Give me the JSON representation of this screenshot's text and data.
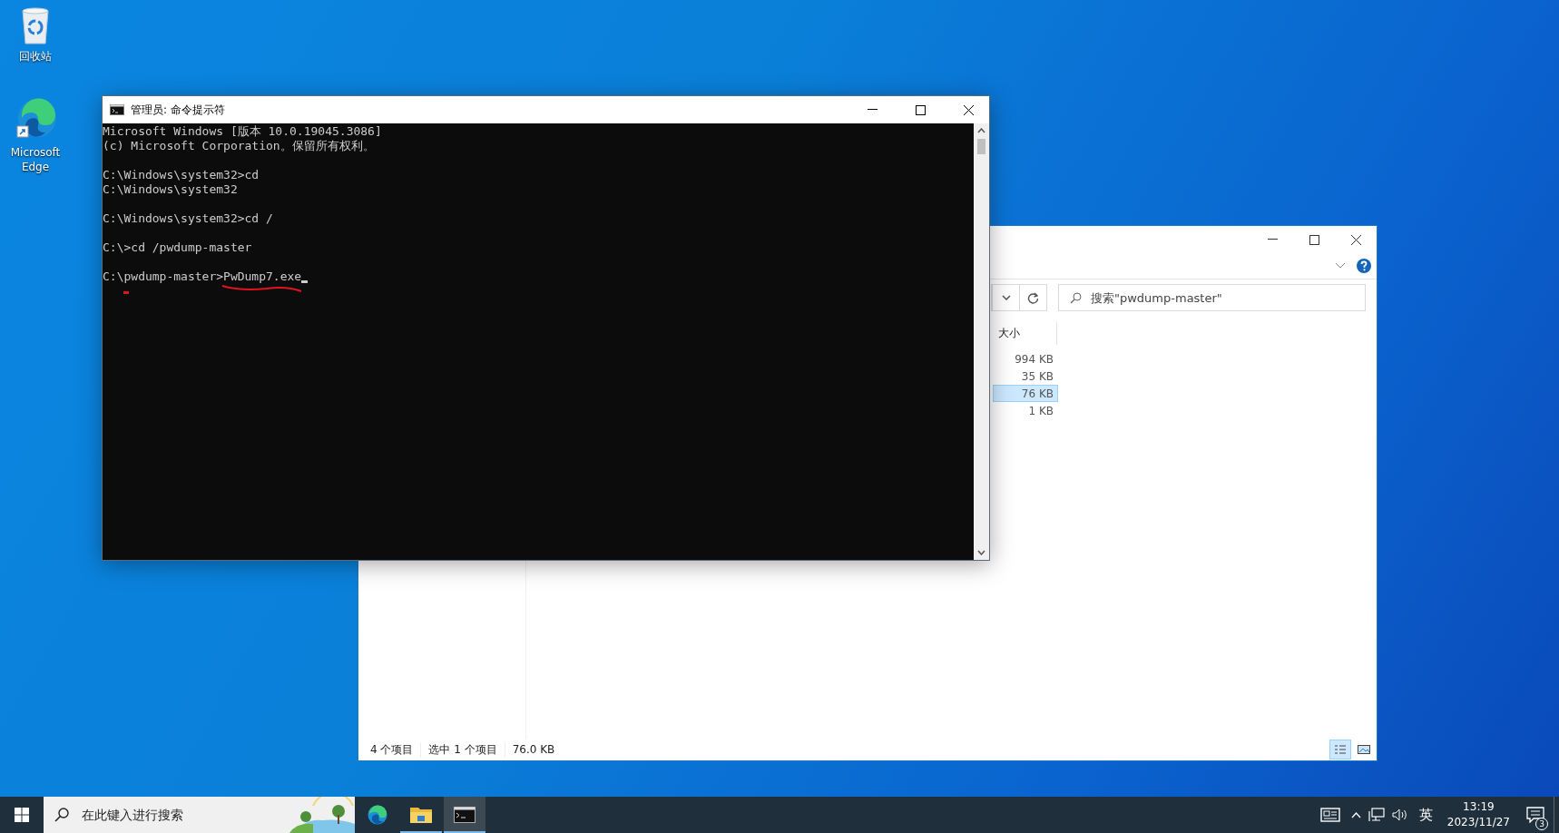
{
  "desktop_icons": [
    {
      "kind": "recycle",
      "label": "回收站"
    },
    {
      "kind": "edge",
      "label": "Microsoft Edge"
    }
  ],
  "explorer": {
    "search": {
      "placeholder": "搜索\"pwdump-master\""
    },
    "size_header": "大小",
    "rows": [
      {
        "size": "994 KB",
        "selected": false
      },
      {
        "size": "35 KB",
        "selected": false
      },
      {
        "size": "76 KB",
        "selected": true
      },
      {
        "size": "1 KB",
        "selected": false
      }
    ],
    "status_bar": {
      "items": "4 个项目",
      "selection": "选中 1 个项目",
      "size": "76.0 KB"
    }
  },
  "console": {
    "title": "管理员: 命令提示符",
    "blocks": [
      [
        "Microsoft Windows [版本 10.0.19045.3086]",
        "(c) Microsoft Corporation。保留所有权利。"
      ],
      [
        "C:\\Windows\\system32>cd",
        "C:\\Windows\\system32"
      ],
      [
        "C:\\Windows\\system32>cd /"
      ],
      [
        "C:\\>cd /pwdump-master"
      ]
    ],
    "input_line": {
      "prompt": "C:\\pwdump-master>",
      "command": "PwDump7.exe"
    }
  },
  "taskbar": {
    "search": {
      "placeholder": "在此键入进行搜索"
    },
    "apps": [
      {
        "kind": "edge",
        "selected": false,
        "running": false
      },
      {
        "kind": "folder",
        "selected": false,
        "running": true
      },
      {
        "kind": "console",
        "selected": true,
        "running": true
      }
    ],
    "input_method": "英",
    "time": "13:19",
    "date": "2023/11/27",
    "notification_count": "3"
  }
}
